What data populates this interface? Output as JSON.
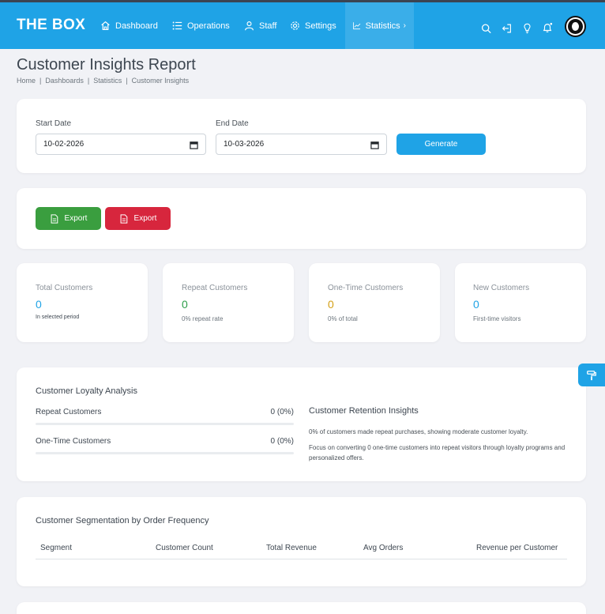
{
  "navbar": {
    "brand": "THE BOX",
    "items": [
      {
        "label": "Dashboard",
        "icon": "home-icon"
      },
      {
        "label": "Operations",
        "icon": "list-icon"
      },
      {
        "label": "Staff",
        "icon": "user-icon"
      },
      {
        "label": "Settings",
        "icon": "gear-icon"
      },
      {
        "label": "Statistics",
        "icon": "chart-line-icon",
        "active": true
      }
    ],
    "right_icons": [
      "search-icon",
      "logout-icon",
      "lightbulb-icon",
      "bell-icon",
      "avatar"
    ],
    "color": "#1fa3e6"
  },
  "page": {
    "title": "Customer Insights Report",
    "breadcrumb": [
      "Home",
      "Dashboards",
      "Statistics",
      "Customer Insights"
    ]
  },
  "filters": {
    "start_label": "Start Date",
    "start_value": "10-02-2026",
    "end_label": "End Date",
    "end_value": "10-03-2026",
    "generate_label": "Generate"
  },
  "exports": {
    "excel_label": "Export",
    "excel_color": "#3a9e3f",
    "pdf_label": "Export",
    "pdf_color": "#d7263d"
  },
  "stats": [
    {
      "title": "Total Customers",
      "value": "0",
      "note": "In selected period",
      "color": "#1fa3e6"
    },
    {
      "title": "Repeat Customers",
      "value": "0",
      "note": "0% repeat rate",
      "color": "#2e9e4a"
    },
    {
      "title": "One-Time Customers",
      "value": "0",
      "note": "0% of total",
      "color": "#d4a017"
    },
    {
      "title": "New Customers",
      "value": "0",
      "note": "First-time visitors",
      "color": "#1fa3e6"
    }
  ],
  "loyalty": {
    "title": "Customer Loyalty Analysis",
    "rows": [
      {
        "label": "Repeat Customers",
        "value": "0 (0%)",
        "percent": 0
      },
      {
        "label": "One-Time Customers",
        "value": "0 (0%)",
        "percent": 0
      }
    ],
    "insights_title": "Customer Retention Insights",
    "insight_1": "0% of customers made repeat purchases, showing moderate customer loyalty.",
    "insight_2": "Focus on converting 0 one-time customers into repeat visitors through loyalty programs and personalized offers."
  },
  "segmentation": {
    "title": "Customer Segmentation by Order Frequency",
    "columns": [
      "Segment",
      "Customer Count",
      "Total Revenue",
      "Avg Orders",
      "Revenue per Customer"
    ]
  }
}
